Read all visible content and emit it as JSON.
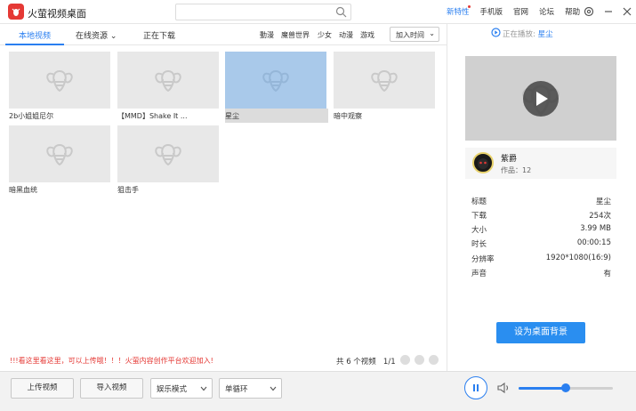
{
  "app": {
    "title": "火萤视频桌面",
    "search_placeholder": ""
  },
  "top_links": [
    "新特性",
    "手机版",
    "官网",
    "论坛",
    "帮助"
  ],
  "tabs": {
    "local": "本地视频",
    "online": "在线资源",
    "download": "正在下载"
  },
  "categories": [
    "動漫",
    "魔兽世界",
    "少女",
    "动漫",
    "游戏"
  ],
  "sort": {
    "selected": "加入时间"
  },
  "videos": [
    {
      "title": "2b小姐姐尼尔"
    },
    {
      "title": "【MMD】Shake It ..."
    },
    {
      "title": "星尘"
    },
    {
      "title": "暗中观察"
    },
    {
      "title": "暗黑血统"
    },
    {
      "title": "狙击手"
    }
  ],
  "notice": "!!!看这里看这里，可以上传哦！！！火萤内容创作平台欢迎加入!",
  "pager": {
    "total": "共 6 个视频",
    "page": "1/1"
  },
  "now_playing": {
    "label": "正在播放:",
    "title": "星尘"
  },
  "author": {
    "name": "紫爵",
    "works": "作品：12"
  },
  "info": [
    {
      "k": "标题",
      "v": "星尘"
    },
    {
      "k": "下载",
      "v": "254次"
    },
    {
      "k": "大小",
      "v": "3.99 MB"
    },
    {
      "k": "时长",
      "v": "00:00:15"
    },
    {
      "k": "分辨率",
      "v": "1920*1080(16:9)"
    },
    {
      "k": "声音",
      "v": "有"
    }
  ],
  "set_bg_label": "设为桌面背景",
  "footer": {
    "upload": "上传视频",
    "import": "导入视频",
    "mode": "娱乐模式",
    "loop": "单循环"
  },
  "volume": {
    "level_percent": 50
  },
  "colors": {
    "accent": "#2a7ff0",
    "brand": "#e53935",
    "notice": "#e53935"
  }
}
